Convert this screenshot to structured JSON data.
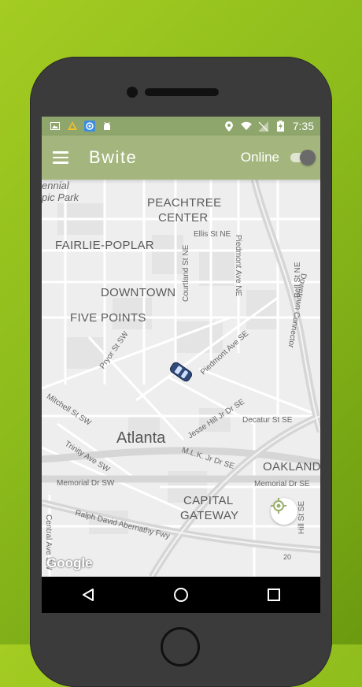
{
  "status_bar": {
    "time": "7:35",
    "left_icons": [
      "image-icon",
      "navigation-app-icon",
      "settings-app-icon",
      "android-icon"
    ],
    "right_icons": [
      "location-pin-icon",
      "wifi-icon",
      "no-sim-icon",
      "battery-charging-icon"
    ]
  },
  "toolbar": {
    "title": "Bwite",
    "online_label": "Online",
    "online_toggle": "off",
    "menu_icon": "hamburger-menu-icon"
  },
  "map": {
    "districts": {
      "peachtree_center_1": "PEACHTREE",
      "peachtree_center_2": "CENTER",
      "fairlie_poplar": "FAIRLIE-POPLAR",
      "downtown": "DOWNTOWN",
      "five_points": "FIVE POINTS",
      "oakland": "OAKLAND",
      "capital_gateway_1": "CAPITAL",
      "capital_gateway_2": "GATEWAY",
      "centennial_1": "ennial",
      "centennial_2": "pic Park"
    },
    "city": "Atlanta",
    "streets": {
      "ellis": "Ellis St NE",
      "courtland": "Courtland St NE",
      "piedmont_ne": "Piedmont Ave NE",
      "bell": "Bell St NE",
      "downtown_connector": "Downtown Connector",
      "pryor": "Pryor St SW",
      "piedmont_se": "Piedmont Ave SE",
      "mitchell": "Mitchell St SW",
      "jesse_hill": "Jesse Hill Jr Dr SE",
      "decatur": "Decatur St SE",
      "trinity": "Trinity Ave SW",
      "mlk": "M.L.K. Jr Dr SE",
      "memorial_sw": "Memorial Dr SW",
      "memorial_se": "Memorial Dr SE",
      "ralph": "Ralph David Abernathy Fwy",
      "central": "Central Ave SW",
      "hill": "Hill St SE",
      "route": "20"
    },
    "google_logo": "Google",
    "locate_icon": "my-location-icon",
    "car_icon": "car-marker-icon"
  },
  "nav_bar": {
    "back_icon": "back-triangle-icon",
    "home_icon": "home-circle-icon",
    "recents_icon": "recents-square-icon"
  },
  "colors": {
    "status_bar": "#8ea56b",
    "toolbar": "#a4b67d",
    "background": "#8cbb1c",
    "phone_body": "#3b3b3b"
  }
}
